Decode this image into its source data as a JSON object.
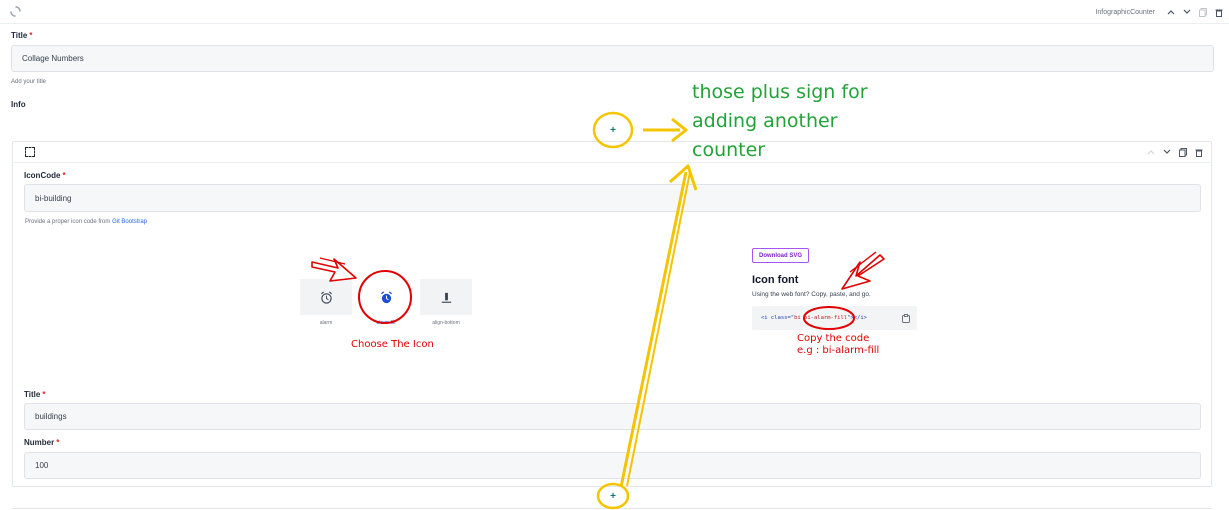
{
  "block": {
    "name": "InfographicCounter"
  },
  "form": {
    "title_label": "Title",
    "title_required": "*",
    "title_value": "Collage Numbers",
    "title_help": "Add your title",
    "info_label": "Info"
  },
  "counter": {
    "iconcode_label": "IconCode",
    "iconcode_required": "*",
    "iconcode_value": "bi-building",
    "iconcode_help": "Provide a proper icon code from",
    "iconcode_help_link": "Git Bootstrap",
    "title_label": "Title",
    "title_required": "*",
    "title_value": "buildings",
    "number_label": "Number",
    "number_required": "*",
    "number_value": "100"
  },
  "icon_picker": {
    "icons": [
      {
        "icon": "alarm-icon",
        "caption": "alarm"
      },
      {
        "icon": "alarm-fill-icon",
        "caption": "alarm-fill"
      },
      {
        "icon": "align-bottom-icon",
        "caption": "align-bottom"
      }
    ]
  },
  "icon_page": {
    "download_label": "Download SVG",
    "font_title": "Icon font",
    "font_subtitle": "Using the web font? Copy, paste, and go.",
    "code_open": "<i class=\"",
    "code_value": "bi bi-alarm-fill",
    "code_close": "\"></i>"
  },
  "annotations": {
    "plus_line1": "those plus sign for",
    "plus_line2": "adding another",
    "plus_line3": "counter",
    "choose_icon": "Choose The Icon",
    "copy_line1": "Copy the code",
    "copy_line2": "e.g : bi-alarm-fill"
  },
  "colors": {
    "annotation_green": "#22a33a",
    "annotation_red": "#e00000",
    "annotation_yellow": "#f5c400",
    "plus_teal": "#0f766e"
  }
}
